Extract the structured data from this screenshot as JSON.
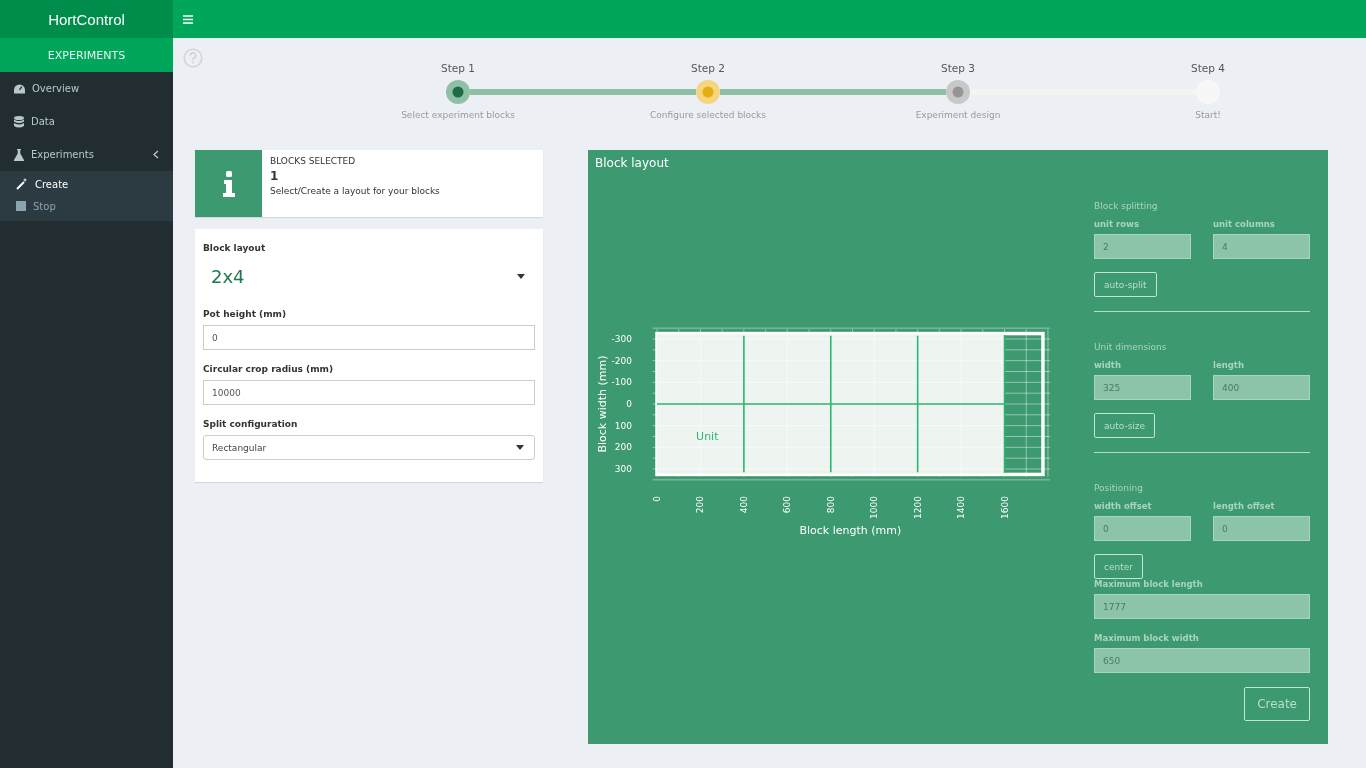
{
  "app": {
    "title": "HortControl",
    "section": "EXPERIMENTS"
  },
  "sidebar": {
    "items": [
      {
        "label": "Overview",
        "selected": false
      },
      {
        "label": "Data",
        "selected": false
      },
      {
        "label": "Experiments",
        "selected": false,
        "expanded": true,
        "children": [
          {
            "label": "Create",
            "selected": true
          },
          {
            "label": "Stop",
            "selected": false
          }
        ]
      }
    ]
  },
  "steps": [
    {
      "title": "Step 1",
      "caption": "Select experiment blocks",
      "kind": "done"
    },
    {
      "title": "Step 2",
      "caption": "Configure selected blocks",
      "kind": "current"
    },
    {
      "title": "Step 3",
      "caption": "Experiment design",
      "kind": "next"
    },
    {
      "title": "Step 4",
      "caption": "Start!",
      "kind": "pending"
    }
  ],
  "info_box": {
    "title": "BLOCKS SELECTED",
    "value": "1",
    "text": "Select/Create a layout for your blocks"
  },
  "settings": {
    "block_layout": {
      "label": "Block layout",
      "value": "2x4"
    },
    "fields": [
      {
        "label": "Pot height (mm)",
        "value": "0"
      },
      {
        "label": "Circular crop radius (mm)",
        "value": "10000"
      }
    ],
    "split": {
      "label": "Split configuration",
      "value": "Rectangular"
    }
  },
  "layout_panel": {
    "title": "Block layout",
    "plot": {
      "xlabel": "Block length (mm)",
      "ylabel": "Block width (mm)",
      "unit_label": "Unit",
      "xticks": [
        "0",
        "200",
        "400",
        "600",
        "800",
        "1000",
        "1200",
        "1400",
        "1600"
      ],
      "yticks": [
        "-300",
        "-200",
        "-100",
        "0",
        "100",
        "200",
        "300"
      ]
    },
    "sections": [
      {
        "heading": "Block splitting",
        "fields": [
          {
            "label": "unit rows",
            "value": "2"
          },
          {
            "label": "unit columns",
            "value": "4"
          }
        ],
        "button": "auto-split"
      },
      {
        "heading": "Unit dimensions",
        "fields": [
          {
            "label": "width",
            "value": "325"
          },
          {
            "label": "length",
            "value": "400"
          }
        ],
        "button": "auto-size"
      },
      {
        "heading": "Positioning",
        "fields": [
          {
            "label": "width offset",
            "value": "0"
          },
          {
            "label": "length offset",
            "value": "0"
          }
        ],
        "button": "center"
      }
    ],
    "max_fields": [
      {
        "label": "Maximum block length",
        "value": "1777"
      },
      {
        "label": "Maximum block width",
        "value": "650"
      }
    ],
    "create_button": "Create"
  }
}
